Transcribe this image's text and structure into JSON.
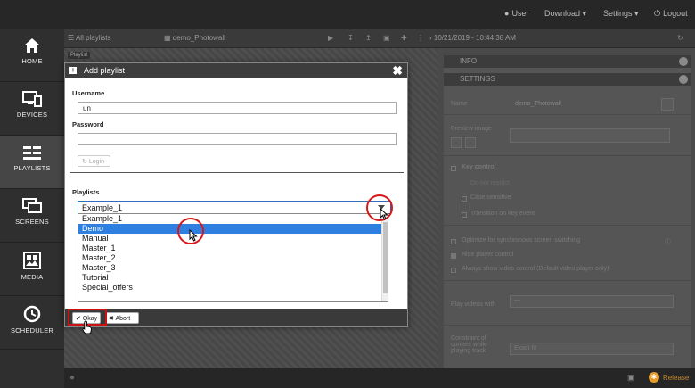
{
  "topbar": {
    "user": "User",
    "download": "Download",
    "settings": "Settings",
    "logout": "Logout"
  },
  "sidebar": {
    "items": [
      {
        "label": "HOME",
        "icon": "home-icon"
      },
      {
        "label": "DEVICES",
        "icon": "devices-icon"
      },
      {
        "label": "PLAYLISTS",
        "icon": "playlists-icon"
      },
      {
        "label": "SCREENS",
        "icon": "screens-icon"
      },
      {
        "label": "MEDIA",
        "icon": "media-icon"
      },
      {
        "label": "SCHEDULER",
        "icon": "clock-icon"
      }
    ]
  },
  "toolbar": {
    "all_playlists": "All playlists",
    "current_playlist": "demo_Photowall",
    "timestamp": "10/21/2019 - 10:44:38 AM",
    "playlist_tag": "Playlist"
  },
  "panel": {
    "info_header": "INFO",
    "settings_header": "SETTINGS",
    "name_label": "Name",
    "name_value": "demo_Photowall",
    "preview_label": "Preview image",
    "key_control": "Key control",
    "do_not_restrict": "Do not restrict",
    "case_sensitive": "Case sensitive",
    "transition": "Transition on key event",
    "optimize": "Optimize for synchronous screen switching",
    "hide_player_control": "Hide player control",
    "always_show": "Always show video control (Default video player only)",
    "play_videos_with": "Play videos with",
    "play_videos_value": "---",
    "constraint_label": "Constraint of content while playing track",
    "constraint_value": "Exact fit",
    "release": "Release"
  },
  "modal": {
    "title": "Add playlist",
    "username_label": "Username",
    "username_value": "un",
    "password_label": "Password",
    "login_button": "Login",
    "playlists_label": "Playlists",
    "selected_value": "Example_1",
    "options": [
      "Example_1",
      "Demo",
      "Manual",
      "Master_1",
      "Master_2",
      "Master_3",
      "Tutorial",
      "Special_offers"
    ],
    "highlighted_option": "Demo",
    "okay_button": "Okay",
    "abort_button": "Abort"
  },
  "colors": {
    "highlight": "#2e7fe0",
    "annotation_red": "#d81818",
    "release_accent": "#e89a2a"
  }
}
